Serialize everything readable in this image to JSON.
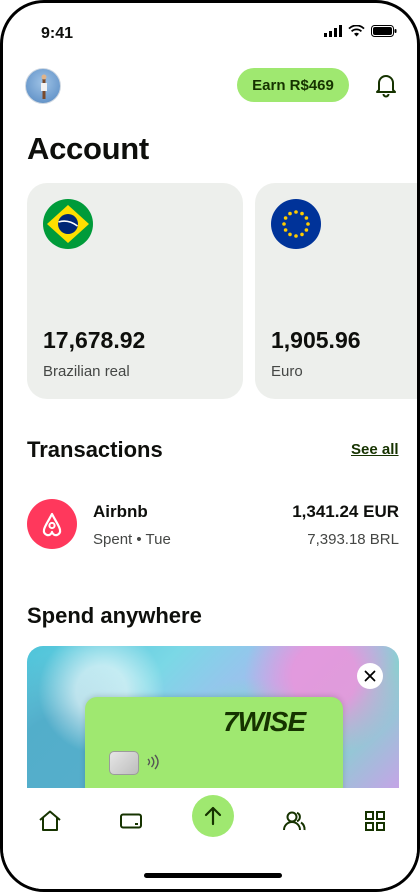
{
  "status_bar": {
    "time": "9:41"
  },
  "header": {
    "earn_label": "Earn R$469"
  },
  "page": {
    "title": "Account"
  },
  "balances": [
    {
      "amount": "17,678.92",
      "currency": "Brazilian real",
      "flag": "brazil-flag-icon"
    },
    {
      "amount": "1,905.96",
      "currency": "Euro",
      "flag": "eu-flag-icon"
    }
  ],
  "transactions": {
    "title": "Transactions",
    "see_all": "See all",
    "items": [
      {
        "name": "Airbnb",
        "subtitle": "Spent • Tue",
        "amount": "1,341.24 EUR",
        "converted": "7,393.18 BRL",
        "logo": "airbnb-logo-icon"
      }
    ]
  },
  "spend": {
    "title": "Spend anywhere",
    "card_brand": "7WISE"
  },
  "nav": {
    "items": [
      "home-icon",
      "card-icon",
      "send-icon",
      "recipients-icon",
      "more-apps-icon"
    ]
  },
  "colors": {
    "accent": "#9fe870",
    "accent_dark": "#163300",
    "card_bg": "#edefec",
    "airbnb": "#ff385c"
  }
}
